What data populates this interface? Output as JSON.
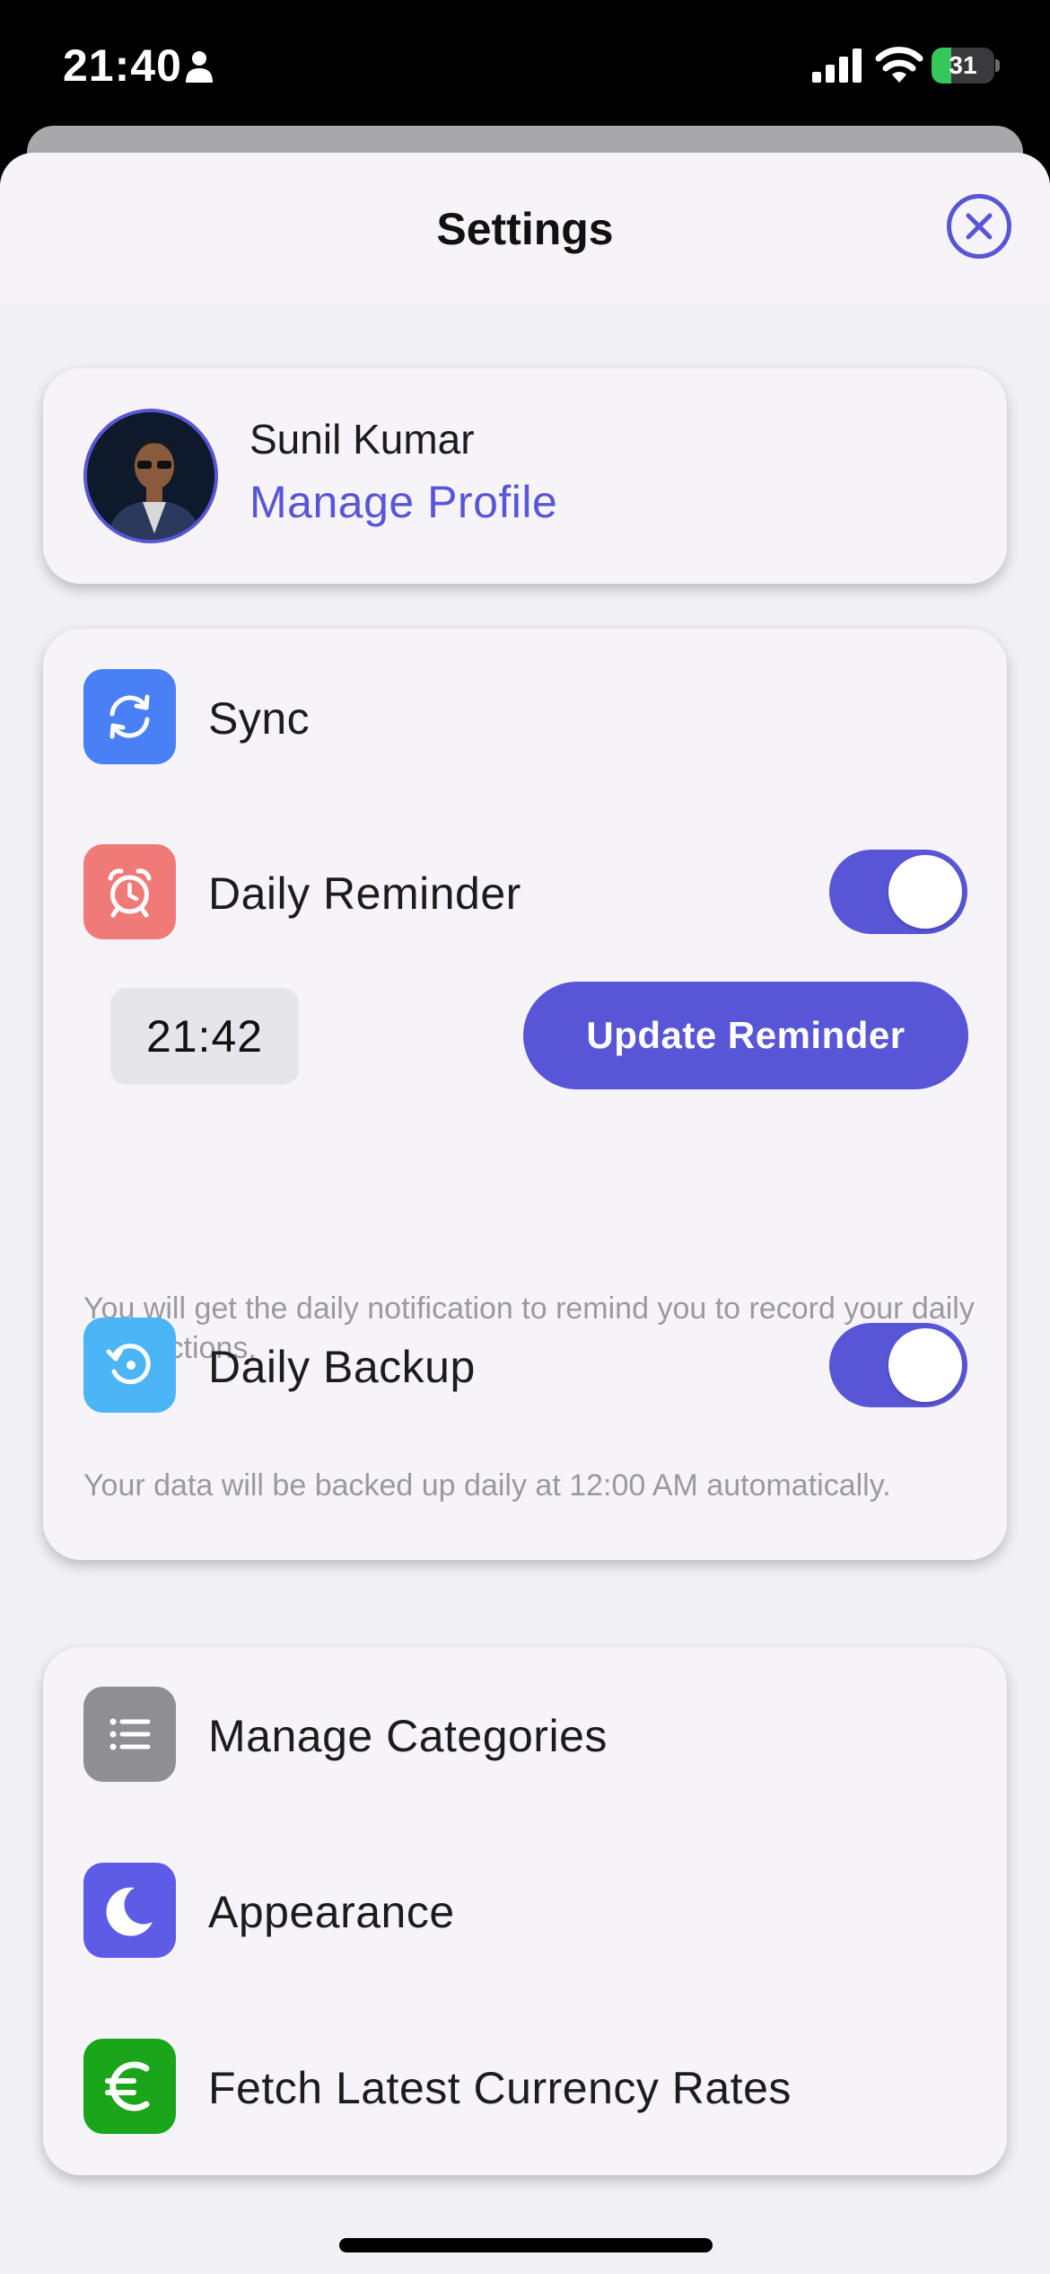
{
  "status_bar": {
    "time": "21:40",
    "battery_level": "31",
    "battery_percent": 31,
    "icons": [
      "person-icon",
      "signal-icon",
      "wifi-icon",
      "battery-charging-icon"
    ]
  },
  "header": {
    "title": "Settings",
    "close_icon": "close-circle-icon"
  },
  "profile": {
    "name": "Sunil Kumar",
    "link": "Manage Profile"
  },
  "settings": {
    "sync": {
      "label": "Sync",
      "icon": "sync-icon",
      "color": "#4a80f5"
    },
    "daily_reminder": {
      "label": "Daily Reminder",
      "icon": "alarm-clock-icon",
      "color": "#f07a78",
      "enabled": true,
      "time": "21:42",
      "button_label": "Update Reminder",
      "helper": "You will get the daily notification to remind you to record your daily transactions."
    },
    "daily_backup": {
      "label": "Daily Backup",
      "icon": "backup-restore-icon",
      "color": "#4cb5f5",
      "enabled": true,
      "helper": "Your data will be backed up daily at 12:00 AM automatically."
    }
  },
  "menu": {
    "manage_categories": {
      "label": "Manage Categories",
      "icon": "list-icon",
      "color": "#8e8e93"
    },
    "appearance": {
      "label": "Appearance",
      "icon": "moon-icon",
      "color": "#5e5ce6"
    },
    "currency": {
      "label": "Fetch Latest Currency Rates",
      "icon": "euro-icon",
      "color": "#1aa51a"
    }
  },
  "colors": {
    "accent": "#5856d6",
    "background": "#f1f0f5",
    "card": "#f7f4f9"
  }
}
